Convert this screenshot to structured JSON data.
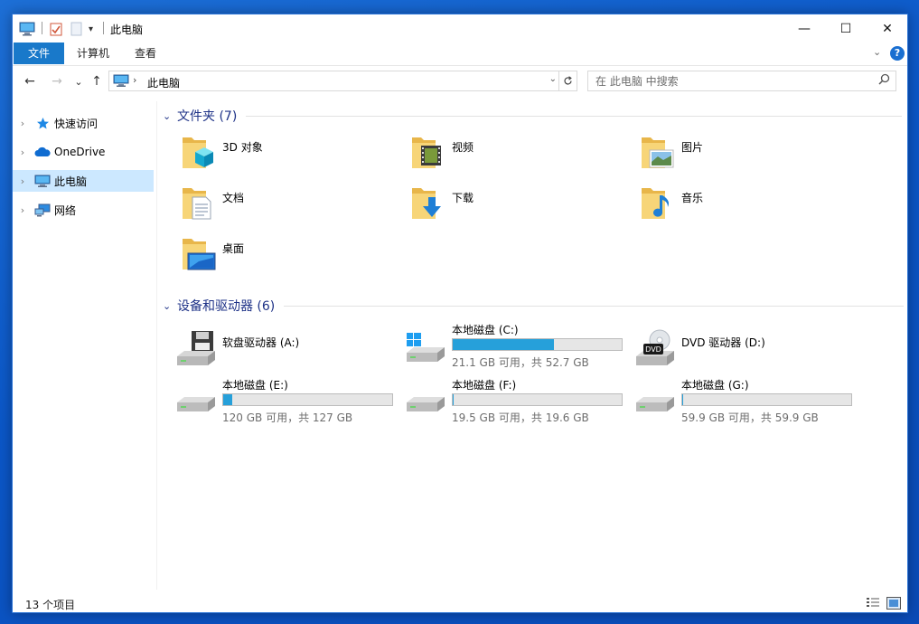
{
  "window": {
    "title": "此电脑",
    "controls": {
      "minimize": "—",
      "maximize": "☐",
      "close": "✕"
    }
  },
  "ribbon": {
    "tabs": [
      "文件",
      "计算机",
      "查看"
    ],
    "expand_icon": "chevron-down-icon",
    "help_label": "?"
  },
  "nav": {
    "back": "←",
    "forward": "→",
    "recent": "⌄",
    "up": "↑",
    "address": {
      "crumb": "此电脑",
      "separator": "›"
    },
    "search": {
      "placeholder": "在 此电脑 中搜索"
    }
  },
  "navpane": {
    "items": [
      {
        "label": "快速访问",
        "icon": "star-icon",
        "selected": false
      },
      {
        "label": "OneDrive",
        "icon": "cloud-icon",
        "selected": false
      },
      {
        "label": "此电脑",
        "icon": "computer-icon",
        "selected": true
      },
      {
        "label": "网络",
        "icon": "network-icon",
        "selected": false
      }
    ]
  },
  "folders": {
    "title": "文件夹 (7)",
    "items": [
      {
        "label": "3D 对象",
        "icon": "3d-objects-folder-icon"
      },
      {
        "label": "视频",
        "icon": "videos-folder-icon"
      },
      {
        "label": "图片",
        "icon": "pictures-folder-icon"
      },
      {
        "label": "文档",
        "icon": "documents-folder-icon"
      },
      {
        "label": "下载",
        "icon": "downloads-folder-icon"
      },
      {
        "label": "音乐",
        "icon": "music-folder-icon"
      },
      {
        "label": "桌面",
        "icon": "desktop-folder-icon"
      }
    ]
  },
  "drives": {
    "title": "设备和驱动器 (6)",
    "items": [
      {
        "label": "软盘驱动器 (A:)",
        "icon": "floppy-drive-icon",
        "has_bar": false
      },
      {
        "label": "本地磁盘 (C:)",
        "icon": "windows-drive-icon",
        "has_bar": true,
        "used_fraction": 0.6,
        "free_text": "21.1 GB 可用，共 52.7 GB"
      },
      {
        "label": "DVD 驱动器 (D:)",
        "icon": "dvd-drive-icon",
        "has_bar": false,
        "badge": "DVD"
      },
      {
        "label": "本地磁盘 (E:)",
        "icon": "hard-drive-icon",
        "has_bar": true,
        "used_fraction": 0.055,
        "free_text": "120 GB 可用，共 127 GB"
      },
      {
        "label": "本地磁盘 (F:)",
        "icon": "hard-drive-icon",
        "has_bar": true,
        "used_fraction": 0.005,
        "free_text": "19.5 GB 可用，共 19.6 GB"
      },
      {
        "label": "本地磁盘 (G:)",
        "icon": "hard-drive-icon",
        "has_bar": true,
        "used_fraction": 0.002,
        "free_text": "59.9 GB 可用，共 59.9 GB"
      }
    ]
  },
  "status": {
    "count": "13 个项目"
  },
  "colors": {
    "accent": "#1979ca",
    "group_title": "#1e3287",
    "bar_fill": "#26a0da",
    "selected_bg": "#cce8ff"
  }
}
